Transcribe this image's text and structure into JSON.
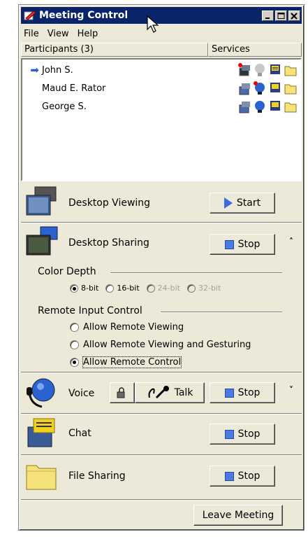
{
  "window": {
    "title": "Meeting Control"
  },
  "menu": [
    "File",
    "View",
    "Help"
  ],
  "columns": {
    "participants": "Participants (3)",
    "services": "Services"
  },
  "participants": [
    {
      "name": "John S.",
      "current": true
    },
    {
      "name": "Maud E. Rator",
      "current": false
    },
    {
      "name": "George S.",
      "current": false
    }
  ],
  "desktop_viewing": {
    "label": "Desktop Viewing",
    "button": "Start"
  },
  "desktop_sharing": {
    "label": "Desktop Sharing",
    "button": "Stop",
    "collapse": "˄",
    "color_depth": {
      "label": "Color Depth",
      "options": [
        "8-bit",
        "16-bit",
        "24-bit",
        "32-bit"
      ],
      "selected": "8-bit"
    },
    "remote_input": {
      "label": "Remote Input Control",
      "options": [
        "Allow Remote Viewing",
        "Allow Remote Viewing and Gesturing",
        "Allow Remote Control"
      ],
      "selected": "Allow Remote Control"
    }
  },
  "voice": {
    "label": "Voice",
    "talk_button": "Talk",
    "stop_button": "Stop",
    "expand": "˅"
  },
  "chat": {
    "label": "Chat",
    "button": "Stop"
  },
  "file_sharing": {
    "label": "File Sharing",
    "button": "Stop"
  },
  "leave_button": "Leave Meeting"
}
